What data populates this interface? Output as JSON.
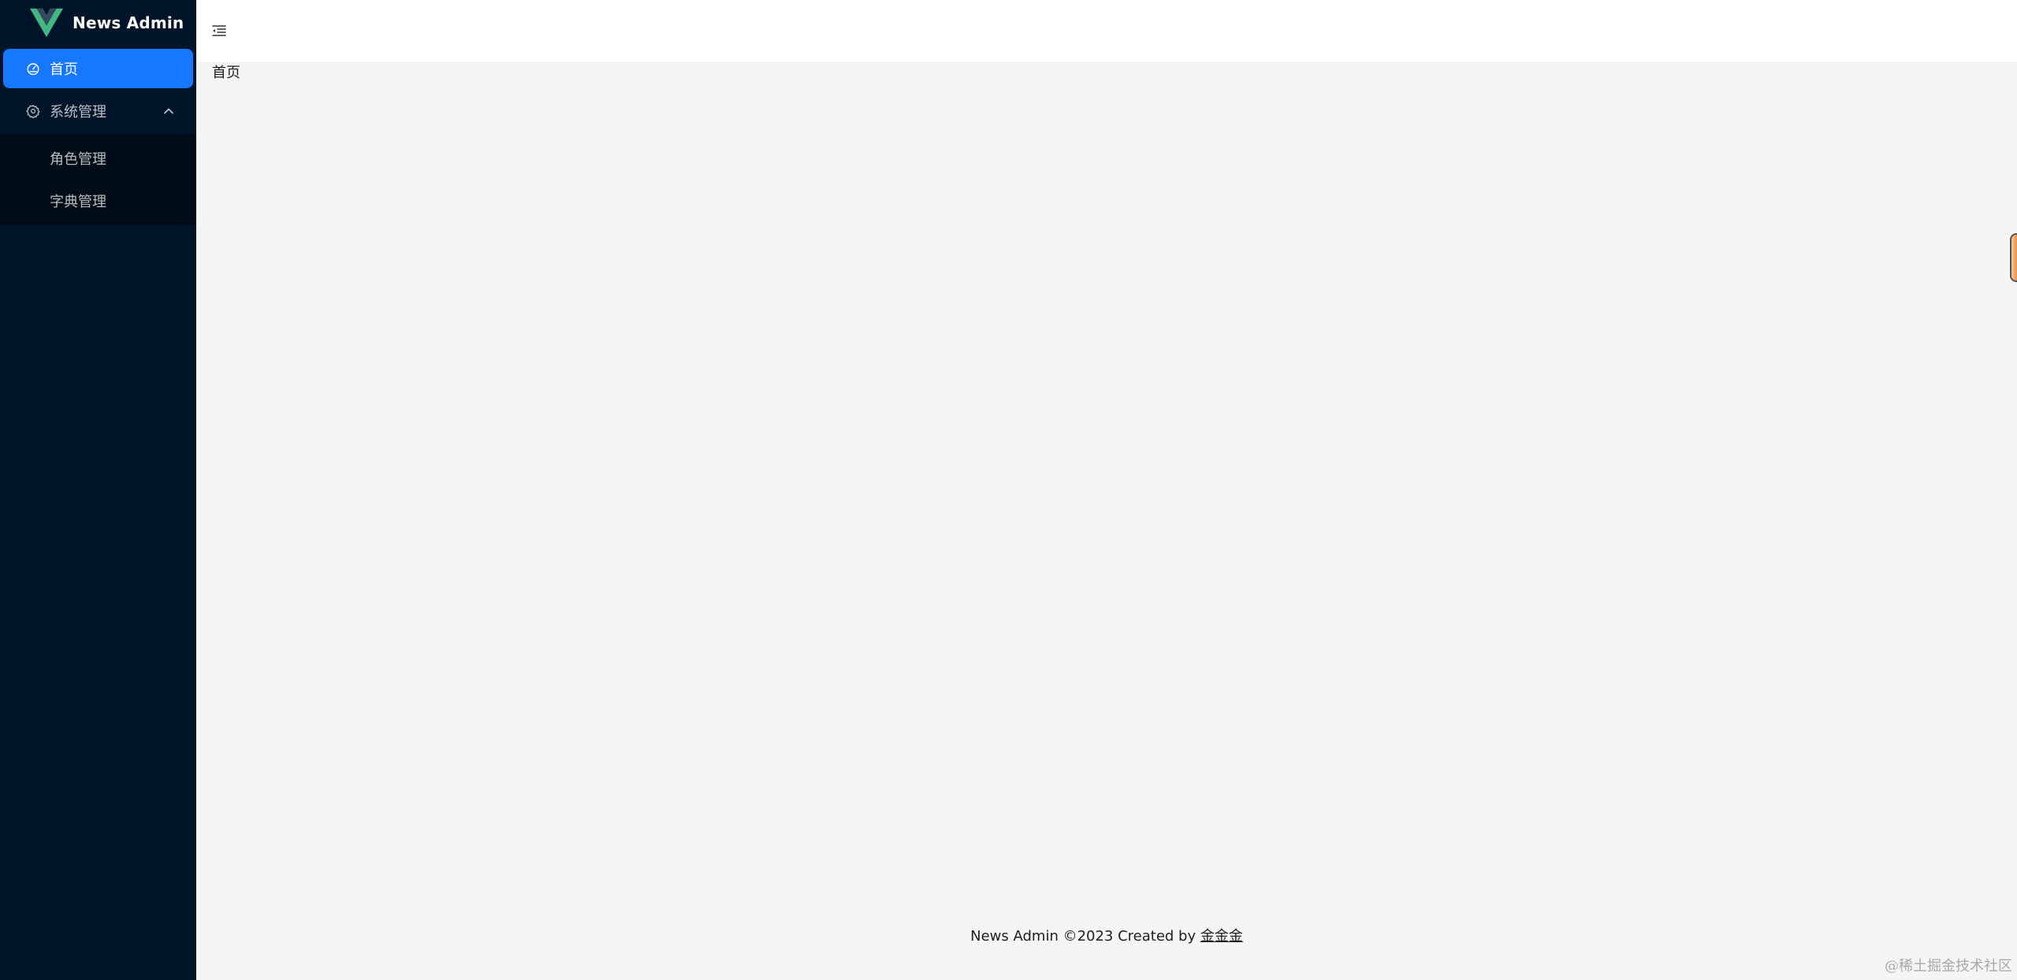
{
  "app": {
    "logo_text": "News Admin",
    "brand_colors": {
      "logo_dark": "#35495e",
      "logo_light": "#41b883",
      "sidebar_bg": "#001529",
      "submenu_bg": "#000c17",
      "active": "#1677ff"
    }
  },
  "sidebar": {
    "items": [
      {
        "label": "首页",
        "icon": "dashboard-icon",
        "active": true
      },
      {
        "label": "系统管理",
        "icon": "gear-icon",
        "expanded": true,
        "children": [
          {
            "label": "角色管理"
          },
          {
            "label": "字典管理"
          }
        ]
      }
    ]
  },
  "header": {
    "toggle_icon": "menu-fold-icon"
  },
  "content": {
    "page_title": "首页"
  },
  "footer": {
    "text": "News Admin ©2023 Created by ",
    "author_link": "金金金"
  },
  "watermark": "@稀土掘金技术社区"
}
